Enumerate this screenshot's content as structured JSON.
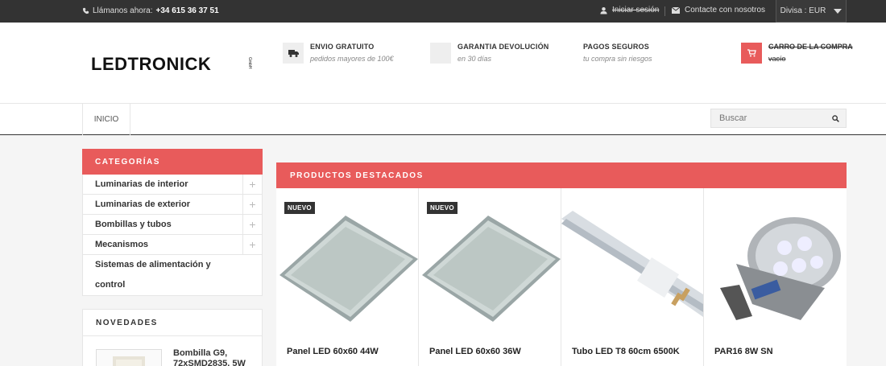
{
  "topbar": {
    "phone_label": "Llámanos ahora:",
    "phone_number": "+34 615 36 37 51",
    "login": "Iniciar sesión",
    "contact": "Contacte con nosotros",
    "currency": "Divisa : EUR"
  },
  "header": {
    "logo_text": "LEDTRONICK",
    "logo_sub": "GmbH",
    "features": [
      {
        "title": "ENVIO GRATUITO",
        "subtitle": "pedidos mayores de 100€",
        "icon": "truck-icon"
      },
      {
        "title": "GARANTIA DEVOLUCIÓN",
        "subtitle": "en 30 días",
        "icon": "return-icon"
      },
      {
        "title": "PAGOS SEGUROS",
        "subtitle": "tu compra sin riesgos",
        "icon": "lock-icon"
      }
    ],
    "cart_title": "CARRO DE LA COMPRA",
    "cart_status": "vacío"
  },
  "nav": {
    "home": "INICIO",
    "search_placeholder": "Buscar"
  },
  "sidebar": {
    "categories_title": "CATEGORÍAS",
    "categories": [
      "Luminarias de interior",
      "Luminarias de exterior",
      "Bombillas y tubos",
      "Mecanismos",
      "Sistemas de alimentación y control"
    ],
    "novedades_title": "NOVEDADES",
    "novedad_item": "Bombilla G9, 72xSMD2835, 5W"
  },
  "featured": {
    "title": "PRODUCTOS DESTACADOS",
    "products": [
      {
        "name": "Panel LED 60x60 44W",
        "badge": "NUEVO"
      },
      {
        "name": "Panel LED 60x60 36W",
        "badge": "NUEVO"
      },
      {
        "name": "Tubo LED T8 60cm 6500K",
        "badge": ""
      },
      {
        "name": "PAR16 8W SN",
        "badge": ""
      }
    ]
  },
  "colors": {
    "accent": "#e85b5b",
    "topbar": "#333333"
  }
}
